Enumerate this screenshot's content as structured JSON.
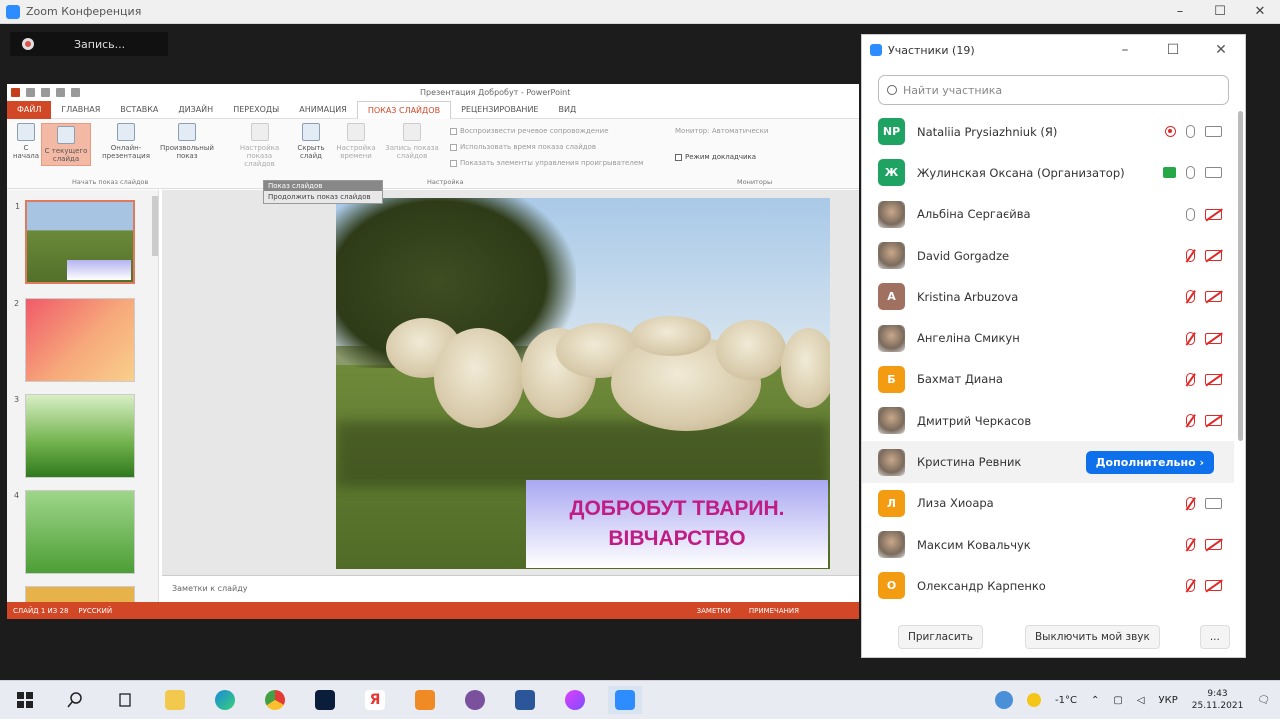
{
  "window": {
    "title": "Zoom Конференция"
  },
  "recording": {
    "label": "Запись..."
  },
  "ppt": {
    "doc_title": "Презентация Добробут - PowerPoint",
    "tabs": [
      "ФАЙЛ",
      "ГЛАВНАЯ",
      "ВСТАВКА",
      "ДИЗАЙН",
      "ПЕРЕХОДЫ",
      "АНИМАЦИЯ",
      "ПОКАЗ СЛАЙДОВ",
      "РЕЦЕНЗИРОВАНИЕ",
      "ВИД"
    ],
    "ribbon": {
      "from_start": "С начала",
      "from_current": "С текущего слайда",
      "online": "Онлайн-презентация",
      "custom": "Произвольный показ",
      "group1": "Начать показ слайдов",
      "setup": "Настройка показа слайдов",
      "hide": "Скрыть слайд",
      "timing": "Настройка времени",
      "record": "Запись показа слайдов",
      "group2": "Настройка",
      "chk1": "Воспроизвести речевое сопровождение",
      "chk2": "Использовать время показа слайдов",
      "chk3": "Показать элементы управления проигрывателем",
      "monitor": "Монитор: Автоматически",
      "presenter": "Режим докладчика",
      "group3": "Мониторы"
    },
    "tooltip": {
      "title": "Показ слайдов",
      "body": "Продолжить показ слайдов"
    },
    "slide_caption_line1": "ДОБРОБУТ ТВАРИН.",
    "slide_caption_line2": "ВІВЧАРСТВО",
    "notes_placeholder": "Заметки к слайду",
    "status_slide": "СЛАЙД 1 ИЗ 28",
    "status_lang": "РУССКИЙ",
    "status_notes": "ЗАМЕТКИ",
    "status_comments": "ПРИМЕЧАНИЯ",
    "thumb_nums": [
      "1",
      "2",
      "3",
      "4"
    ]
  },
  "participants": {
    "title": "Участники (19)",
    "search_placeholder": "Найти участника",
    "list": [
      {
        "initials": "NP",
        "color": "#1ea362",
        "name": "Nataliia Prysiazhniuk (Я)",
        "rec": true,
        "mic": "on",
        "cam": "plain"
      },
      {
        "initials": "Ж",
        "color": "#1ea362",
        "name": "Жулинская Оксана (Организатор)",
        "rec": false,
        "mic": "on",
        "cam": "plain",
        "cam_green": true
      },
      {
        "initials": "",
        "color": "photo",
        "name": "Альбіна Сергаєйва",
        "mic": "on",
        "cam": "off"
      },
      {
        "initials": "",
        "color": "photo",
        "name": "David Gorgadze",
        "mic": "muted",
        "cam": "off"
      },
      {
        "initials": "A",
        "color": "#a07060",
        "name": "Kristina Arbuzova",
        "mic": "muted",
        "cam": "off"
      },
      {
        "initials": "",
        "color": "photo",
        "name": "Ангеліна Смикун",
        "mic": "muted",
        "cam": "off"
      },
      {
        "initials": "Б",
        "color": "#f39c12",
        "name": "Бахмат Диана",
        "mic": "muted",
        "cam": "off"
      },
      {
        "initials": "",
        "color": "photo",
        "name": "Дмитрий Черкасов",
        "mic": "muted",
        "cam": "off"
      },
      {
        "initials": "",
        "color": "photo",
        "name": "Кристина Ревник",
        "more": "Дополнительно ›"
      },
      {
        "initials": "Л",
        "color": "#f39c12",
        "name": "Лиза Хиоара",
        "mic": "muted",
        "cam": "plain"
      },
      {
        "initials": "",
        "color": "photo",
        "name": "Максим Ковальчук",
        "mic": "muted",
        "cam": "off"
      },
      {
        "initials": "О",
        "color": "#f39c12",
        "name": "Олександр Карпенко",
        "mic": "muted",
        "cam": "off"
      }
    ],
    "invite": "Пригласить",
    "mute_me": "Выключить мой звук",
    "more": "..."
  },
  "taskbar": {
    "temp": "-1°C",
    "lang": "УКР",
    "time": "9:43",
    "date": "25.11.2021",
    "apps": [
      "file-explorer",
      "edge",
      "chrome",
      "photoshop",
      "yandex",
      "ppt-store",
      "viber",
      "word",
      "app-purple",
      "zoom"
    ]
  }
}
